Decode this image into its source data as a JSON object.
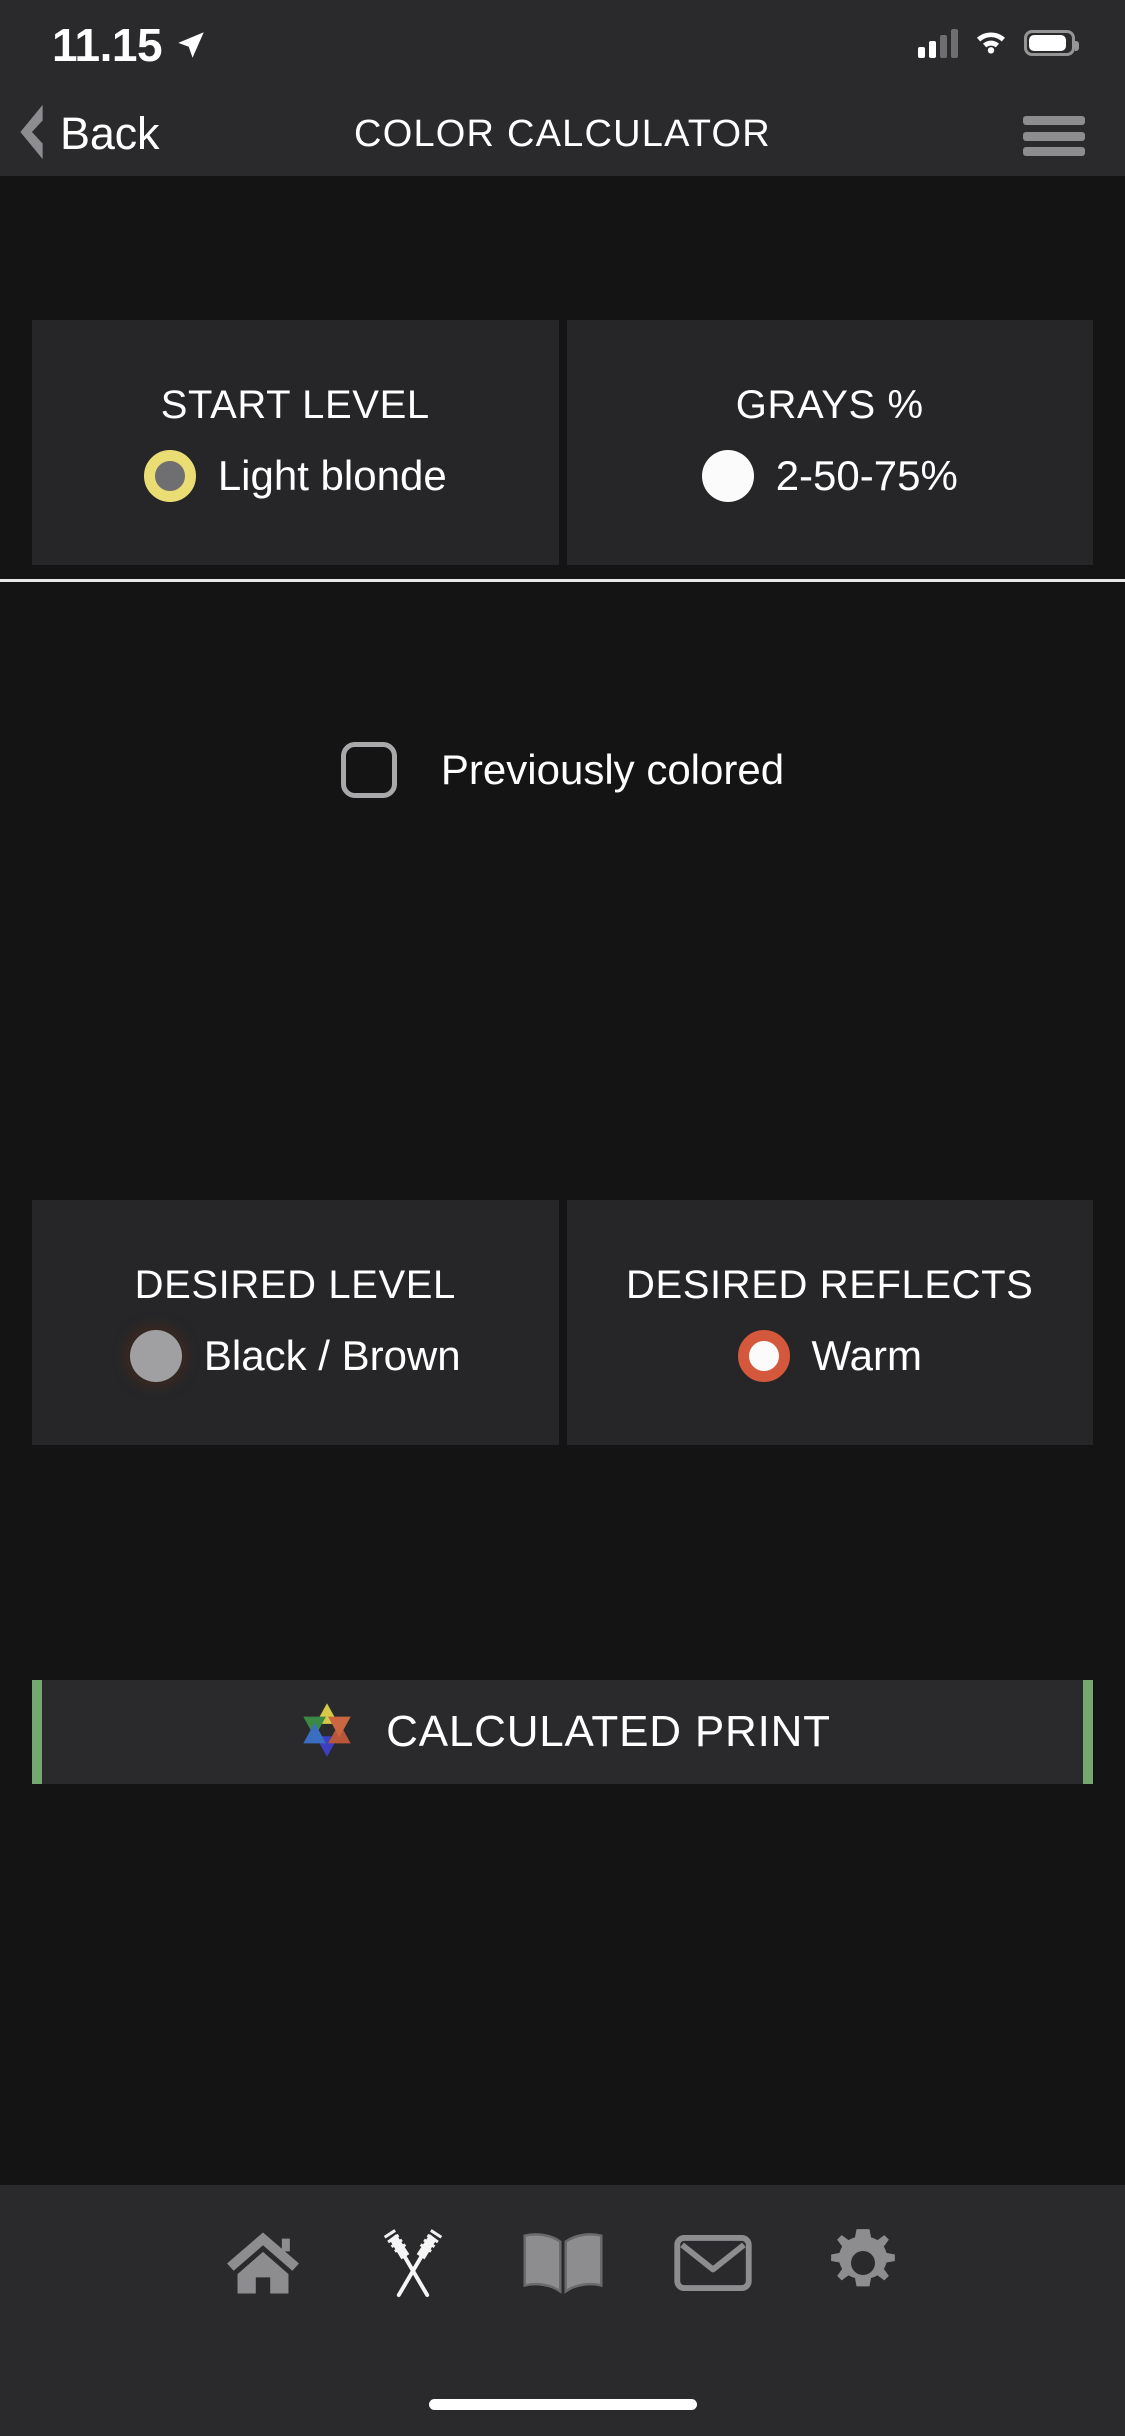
{
  "status_bar": {
    "time": "11.15",
    "location_icon": "location-arrow-icon",
    "signal_icon": "cellular-signal-icon",
    "wifi_icon": "wifi-icon",
    "battery_icon": "battery-icon"
  },
  "nav_bar": {
    "back_label": "Back",
    "back_icon": "chevron-left-icon",
    "title": "COLOR CALCULATOR",
    "menu_icon": "hamburger-menu-icon"
  },
  "start_section": {
    "cards": [
      {
        "title": "START LEVEL",
        "value": "Light blonde",
        "swatch": "ring-yellow",
        "swatch_color": "#e9dd74"
      },
      {
        "title": "GRAYS %",
        "value": "2-50-75%",
        "swatch": "solid-white",
        "swatch_color": "#fbfbfb"
      }
    ],
    "checkbox": {
      "label": "Previously colored",
      "checked": "false"
    }
  },
  "desired_section": {
    "cards": [
      {
        "title": "DESIRED LEVEL",
        "value": "Black / Brown",
        "swatch": "solid-gray",
        "swatch_color": "#a0a0a2"
      },
      {
        "title": "DESIRED REFLECTS",
        "value": "Warm",
        "swatch": "ring-orange",
        "swatch_color": "#d4583c"
      }
    ]
  },
  "action": {
    "label": "CALCULATED PRINT",
    "icon": "color-star-icon",
    "accent_color": "#73a86e"
  },
  "tab_bar": {
    "items": [
      {
        "icon": "home-icon"
      },
      {
        "icon": "crossed-hair-brushes-icon"
      },
      {
        "icon": "open-book-icon"
      },
      {
        "icon": "mail-envelope-icon"
      },
      {
        "icon": "gear-icon"
      }
    ]
  },
  "theme": {
    "background": "#141415",
    "card_background": "#262628",
    "bar_background": "#2a2a2c",
    "text": "#ffffff",
    "accent_green": "#73a86e"
  }
}
